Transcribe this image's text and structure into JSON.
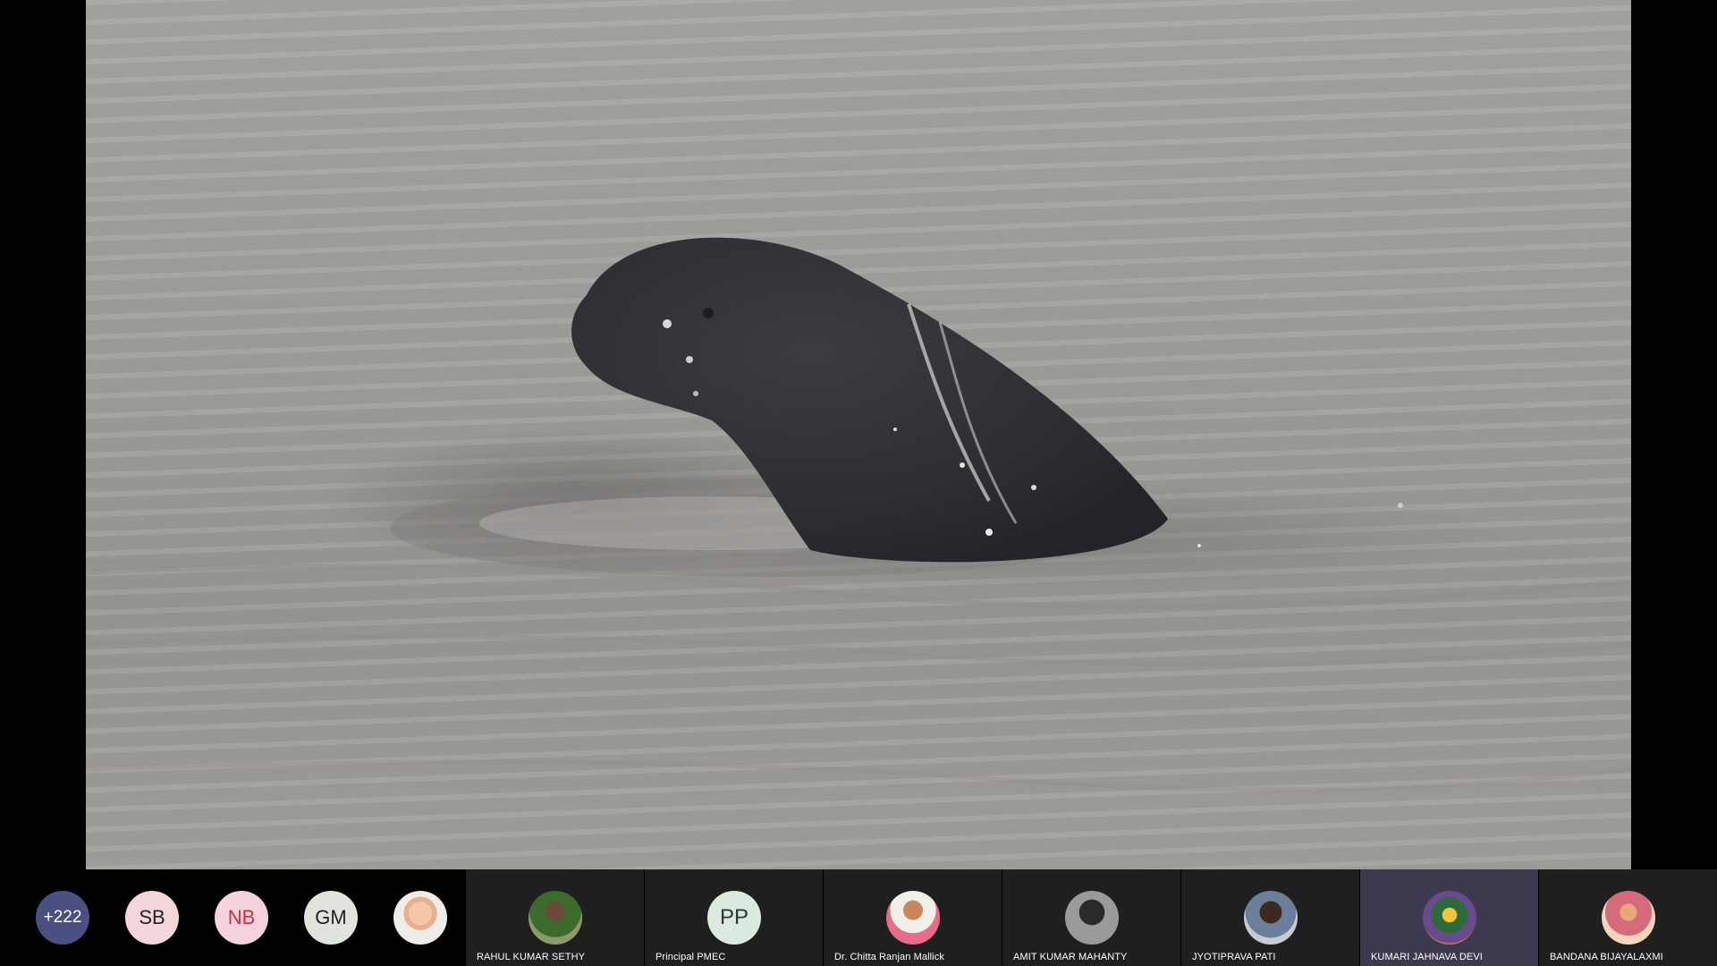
{
  "shared_content": {
    "description": "",
    "colors": {
      "water": "#a3a19d",
      "dolphin": "#2e3034"
    }
  },
  "filmstrip": {
    "overflow": {
      "more_count": "+222",
      "avatars": [
        {
          "initials": "SB"
        },
        {
          "initials": "NB"
        },
        {
          "initials": "GM"
        }
      ]
    },
    "participants": [
      {
        "name": "RAHUL KUMAR SETHY",
        "initials": ""
      },
      {
        "name": "Principal PMEC",
        "initials": "PP"
      },
      {
        "name": "Dr. Chitta Ranjan Mallick",
        "initials": ""
      },
      {
        "name": "AMIT KUMAR MAHANTY",
        "initials": ""
      },
      {
        "name": "JYOTIPRAVA PATI",
        "initials": ""
      },
      {
        "name": "KUMARI JAHNAVA DEVI",
        "initials": ""
      },
      {
        "name": "BANDANA BIJAYALAXMI",
        "initials": ""
      }
    ],
    "active_speaker_color": "#3b3a4f"
  }
}
